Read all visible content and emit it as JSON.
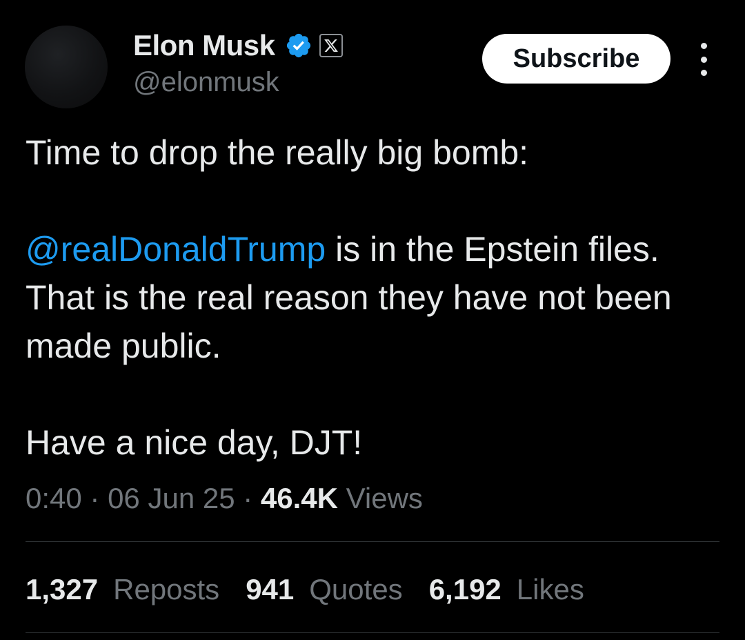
{
  "author": {
    "display_name": "Elon Musk",
    "handle": "@elonmusk",
    "verified_icon": "verified-badge-icon",
    "affiliate_icon": "x-logo-icon"
  },
  "actions": {
    "subscribe_label": "Subscribe",
    "more_icon": "more-vertical-icon"
  },
  "tweet": {
    "line1": "Time to drop the really big bomb:",
    "mention": "@realDonaldTrump",
    "line2_rest": " is in the Epstein files. That is the real reason they have not been made public.",
    "line3": "Have a nice day, DJT!"
  },
  "meta": {
    "time": "0:40",
    "separator": "·",
    "date": "06 Jun 25",
    "views_count": "46.4K",
    "views_label": "Views"
  },
  "stats": {
    "reposts_count": "1,327",
    "reposts_label": "Reposts",
    "quotes_count": "941",
    "quotes_label": "Quotes",
    "likes_count": "6,192",
    "likes_label": "Likes"
  },
  "colors": {
    "background": "#000000",
    "text": "#e7e9ea",
    "secondary_text": "#71767b",
    "link": "#1d9bf0",
    "verified": "#1d9bf0",
    "divider": "#2f3336"
  }
}
